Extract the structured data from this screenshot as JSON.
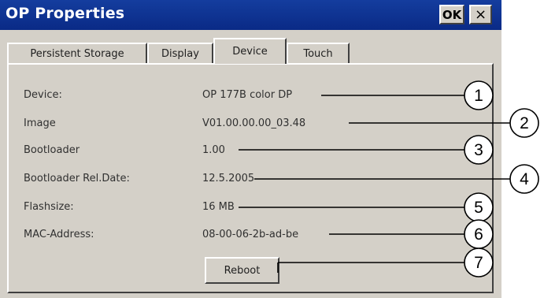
{
  "window": {
    "title": "OP Properties",
    "ok_label": "OK",
    "close_label": "×"
  },
  "tabs": [
    {
      "label": "Persistent Storage"
    },
    {
      "label": "Display"
    },
    {
      "label": "Device",
      "active": true
    },
    {
      "label": "Touch"
    }
  ],
  "fields": [
    {
      "label": "Device:",
      "value": "OP 177B color DP"
    },
    {
      "label": "Image",
      "value": "V01.00.00.00_03.48"
    },
    {
      "label": "Bootloader",
      "value": "1.00"
    },
    {
      "label": "Bootloader Rel.Date:",
      "value": "12.5.2005"
    },
    {
      "label": "Flashsize:",
      "value": "16 MB"
    },
    {
      "label": "MAC-Address:",
      "value": "08-00-06-2b-ad-be"
    }
  ],
  "reboot_label": "Reboot",
  "callouts": [
    "1",
    "2",
    "3",
    "4",
    "5",
    "6",
    "7"
  ]
}
